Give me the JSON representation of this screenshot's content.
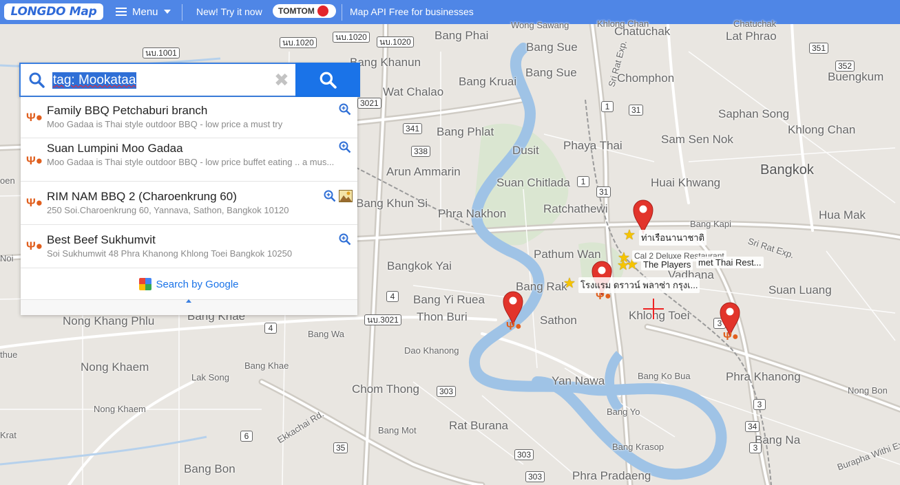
{
  "topbar": {
    "logo": "LONGDO Map",
    "menu_label": "Menu",
    "promo_text": "New! Try it now",
    "tomtom_label": "TOMTOM",
    "api_text": "Map API Free for businesses"
  },
  "search": {
    "query": "tag: Mookataa",
    "clear_symbol": "✖"
  },
  "results": [
    {
      "name": "Family BBQ Petchaburi branch",
      "desc": "Moo Gadaa is Thai style outdoor BBQ - low price a must try"
    },
    {
      "name": "Suan Lumpini Moo Gadaa",
      "desc": "Moo Gadaa is Thai style outdoor BBQ - low price buffet eating .. a mus..."
    },
    {
      "name": "RIM NAM BBQ 2 (Charoenkrung 60)",
      "desc": "250 Soi.Charoenkrung 60, Yannava, Sathon, Bangkok 10120"
    },
    {
      "name": "Best Beef Sukhumvit",
      "desc": "Soi Sukhumwit 48 Phra Khanong Khlong Toei Bangkok 10250"
    }
  ],
  "google_search": "Search by Google",
  "map": {
    "places": [
      "Wong Sawang",
      "Bang Phai",
      "Bang Sue",
      "Chatuchak",
      "Lat Phrao",
      "Bang Khanun",
      "Bang Kruai",
      "Wat Chalao",
      "Bang Sue",
      "Chomphon",
      "Buengkum",
      "Saphan Song",
      "Khlong Chan",
      "Sam Sen Nok",
      "Bang Phlat",
      "Dusit",
      "Phaya Thai",
      "Arun Ammarin",
      "Suan Chitlada",
      "Huai Khwang",
      "Bangkok",
      "Bang Khun Si",
      "Ratchathewi",
      "Phra Nakhon",
      "Bang Kapi",
      "Hua Mak",
      "Pathum Wan",
      "Vadhana",
      "Bangkok Yai",
      "Bang Rak",
      "Suan Luang",
      "Bang Yi Ruea",
      "Thon Buri",
      "Sathon",
      "Khlong Toei",
      "Nong Khang Phlu",
      "Bang Khae",
      "Bang Wa",
      "Dao Khanong",
      "Nong Khaem",
      "Bang Khae",
      "Lak Song",
      "Yan Nawa",
      "Bang Ko Bua",
      "Phra Khanong",
      "Chom Thong",
      "Nong Khaem",
      "Bang Yo",
      "Nong Bon",
      "Rat Burana",
      "Bang Mot",
      "Bang Krasop",
      "Bang Na",
      "Bang Bon",
      "Phra Pradaeng",
      "Khlong Chan",
      "Chatuchak",
      "Krat",
      "Noi",
      "thue",
      "oen"
    ],
    "roads": [
      "Sri Rat Exp.",
      "Sri Rat Exp.",
      "Ekkachai Rd.",
      "Burapha Withi Exp."
    ],
    "shields": [
      "นบ.1001",
      "นบ.1020",
      "นบ.1020",
      "นบ.1020",
      "3021",
      "341",
      "338",
      "1",
      "31",
      "1",
      "31",
      "4",
      "4",
      "นบ.3021",
      "303",
      "303",
      "35",
      "6",
      "34",
      "3",
      "3",
      "3",
      "303",
      "351",
      "352"
    ],
    "poi_labels": [
      "ท่าเรือนานาชาติ",
      "Cal 2 Deluxe Restaurant",
      "The Players",
      "met Thai Rest...",
      "โรงแรม ดราวน์ พลาซ่า กรุงเ..."
    ],
    "colors": {
      "water": "#9fc3e6",
      "land": "#e9e6e1",
      "park": "#cfe3c4",
      "road": "#ffffff",
      "pin": "#e2342b"
    }
  }
}
